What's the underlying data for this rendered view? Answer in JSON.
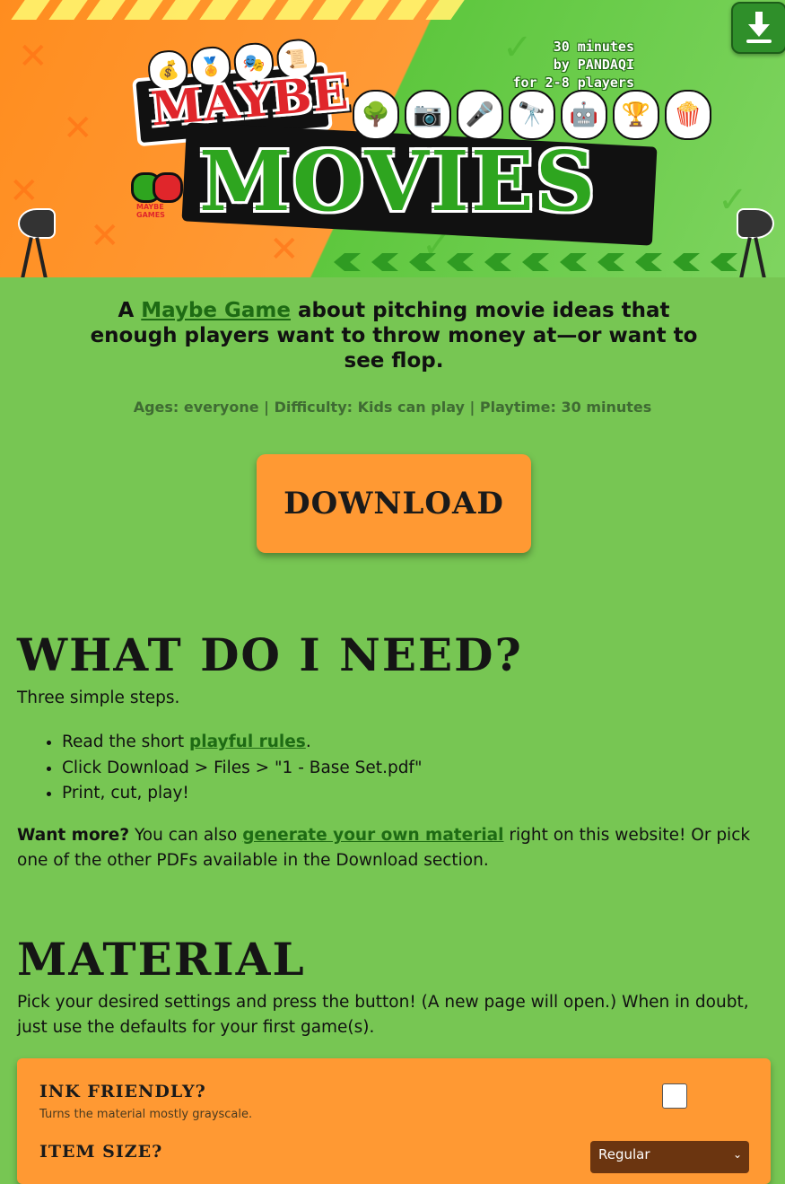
{
  "banner": {
    "logo_top": "MAYBE",
    "logo_main": "MOVIES",
    "mini_logo_text": "MAYBE GAMES",
    "info_lines": [
      "30 minutes",
      "by PANDAQI",
      "for 2-8 players"
    ]
  },
  "intro": {
    "tagline_prefix": "A",
    "tagline_link": "Maybe Game",
    "tagline_rest": "about pitching movie ideas that enough players want to throw money at—or want to see flop.",
    "meta": "Ages: everyone | Difficulty: Kids can play | Playtime: 30 minutes",
    "download_label": "DOWNLOAD"
  },
  "need_section": {
    "heading": "WHAT DO I NEED?",
    "lead": "Three simple steps.",
    "steps": {
      "s1_prefix": "Read the short",
      "s1_link": "playful rules",
      "s1_suffix": ".",
      "s2": "Click Download > Files > \"1 - Base Set.pdf\"",
      "s3": "Print, cut, play!"
    },
    "more_bold": "Want more?",
    "more_text1": "You can also",
    "more_link": "generate your own material",
    "more_text2": "right on this website! Or pick one of the other PDFs available in the Download section."
  },
  "material_section": {
    "heading": "MATERIAL",
    "description": "Pick your desired settings and press the button! (A new page will open.) When in doubt, just use the defaults for your first game(s).",
    "settings": {
      "ink_label": "INK FRIENDLY?",
      "ink_help": "Turns the material mostly grayscale.",
      "ink_checked": false,
      "size_label": "ITEM SIZE?",
      "size_value": "Regular"
    }
  },
  "colors": {
    "page_bg": "#77c653",
    "accent_orange": "#ff9933",
    "link_green": "#1e6b14",
    "logo_red": "#e0262b",
    "logo_green": "#2ea51f"
  }
}
